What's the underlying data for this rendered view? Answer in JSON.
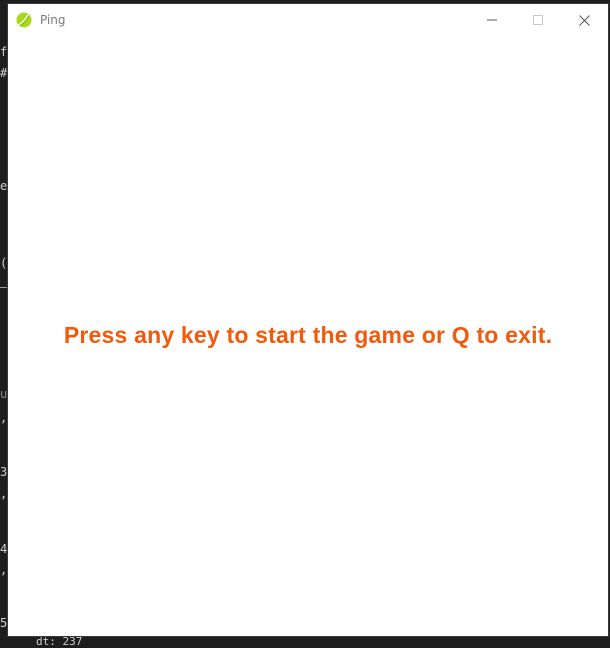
{
  "window": {
    "title": "Ping",
    "icon": "tennis-ball-icon",
    "controls": {
      "minimize_icon": "minimize-icon",
      "maximize_icon": "maximize-icon",
      "close_icon": "close-icon"
    }
  },
  "game": {
    "prompt": "Press any key to start the game or Q to exit.",
    "prompt_color": "#f05a0a",
    "background_color": "#ffffff"
  },
  "background_editor": {
    "fragments": [
      "f",
      "#",
      "e",
      "(",
      "u",
      ",",
      "3",
      ",",
      "4",
      ",",
      "5"
    ],
    "bottom_text": "dt: 237"
  },
  "colors": {
    "icon_green": "#a8d81a",
    "titlebar_text": "#7a7a7a",
    "backdrop": "#1e1e1e"
  }
}
